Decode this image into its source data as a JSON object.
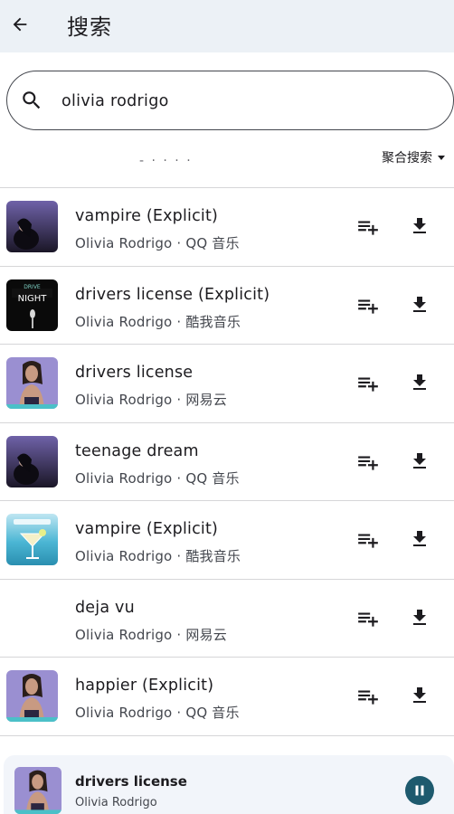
{
  "appbar": {
    "title": "搜索",
    "back_icon": "arrow-left-icon"
  },
  "search": {
    "value": "olivia rodrigo",
    "placeholder": "",
    "icon": "search-icon"
  },
  "source_filter": {
    "selected": "聚合搜索"
  },
  "results": [
    {
      "title": "vampire (Explicit)",
      "subtitle": "Olivia Rodrigo · QQ 音乐",
      "cover": "dark-car-cover"
    },
    {
      "title": "drivers license (Explicit)",
      "subtitle": "Olivia Rodrigo · 酷我音乐",
      "cover": "night-cover"
    },
    {
      "title": "drivers license",
      "subtitle": "Olivia Rodrigo · 网易云",
      "cover": "purple-portrait-cover"
    },
    {
      "title": "teenage dream",
      "subtitle": "Olivia Rodrigo · QQ 音乐",
      "cover": "dark-car-cover"
    },
    {
      "title": "vampire (Explicit)",
      "subtitle": "Olivia Rodrigo · 酷我音乐",
      "cover": "cocktail-cover"
    },
    {
      "title": "deja vu",
      "subtitle": "Olivia Rodrigo · 网易云",
      "cover": ""
    },
    {
      "title": "happier (Explicit)",
      "subtitle": "Olivia Rodrigo · QQ 音乐",
      "cover": "purple-portrait-cover"
    }
  ],
  "player": {
    "title": "drivers license",
    "artist": "Olivia Rodrigo",
    "state_icon": "pause-icon"
  },
  "colors": {
    "appbar_bg": "#ecf1f6",
    "accent": "#1e5a6e",
    "divider": "#d6d6d8"
  }
}
